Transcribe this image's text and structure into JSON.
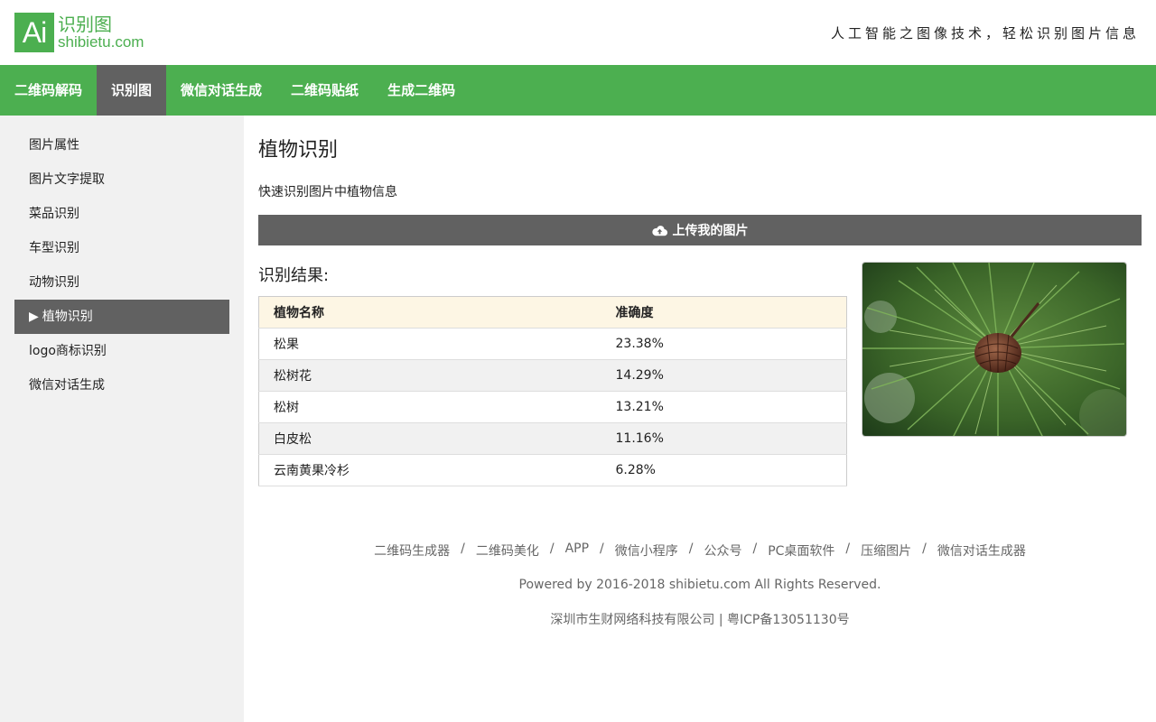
{
  "header": {
    "logo_mark": "Ai",
    "logo_cn": "识别图",
    "logo_en": "shibietu.com",
    "slogan": "人工智能之图像技术，轻松识别图片信息"
  },
  "nav": {
    "items": [
      "二维码解码",
      "识别图",
      "微信对话生成",
      "二维码贴纸",
      "生成二维码"
    ],
    "active_index": 1
  },
  "sidebar": {
    "items": [
      "图片属性",
      "图片文字提取",
      "菜品识别",
      "车型识别",
      "动物识别",
      "植物识别",
      "logo商标识别",
      "微信对话生成"
    ],
    "active_index": 5,
    "active_marker": "▶"
  },
  "main": {
    "title": "植物识别",
    "description": "快速识别图片中植物信息",
    "upload_label": "上传我的图片",
    "result_title": "识别结果:",
    "table": {
      "headers": [
        "植物名称",
        "准确度"
      ],
      "rows": [
        [
          "松果",
          "23.38%"
        ],
        [
          "松树花",
          "14.29%"
        ],
        [
          "松树",
          "13.21%"
        ],
        [
          "白皮松",
          "11.16%"
        ],
        [
          "云南黄果冷杉",
          "6.28%"
        ]
      ]
    }
  },
  "footer": {
    "links": [
      "二维码生成器",
      "二维码美化",
      "APP",
      "微信小程序",
      "公众号",
      "PC桌面软件",
      "压缩图片",
      "微信对话生成器"
    ],
    "separator": "/",
    "copyright": "Powered by 2016-2018 shibietu.com All Rights Reserved.",
    "icp": "深圳市生财网络科技有限公司 | 粤ICP备13051130号"
  },
  "colors": {
    "brand_green": "#4caf50",
    "active_gray": "#616161",
    "table_header_bg": "#fdf6e4"
  }
}
